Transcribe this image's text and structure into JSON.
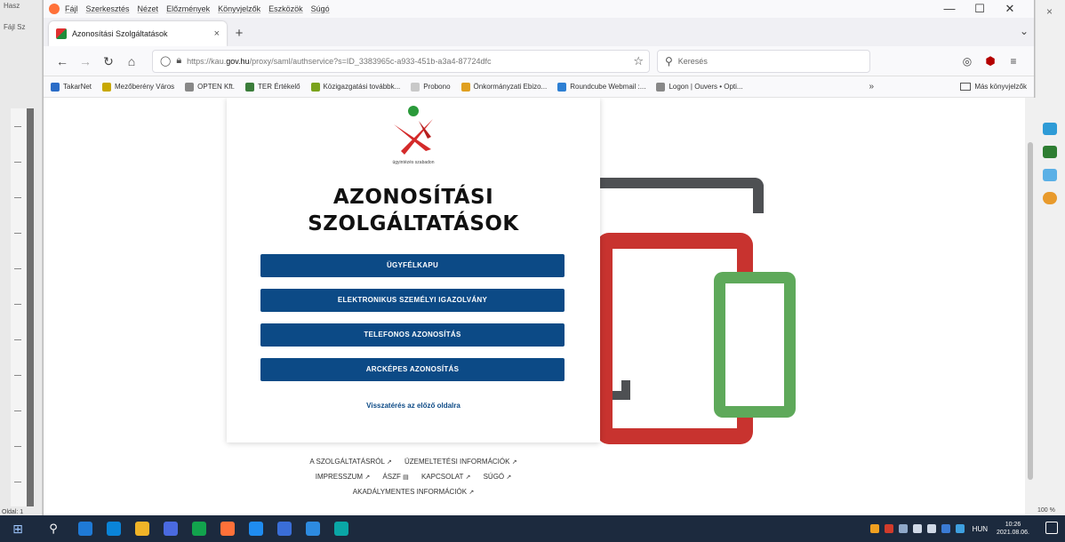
{
  "background_left_app": {
    "title": "Hasz",
    "menu": "Fájl  Sz",
    "status": "Oldal: 1"
  },
  "background_right_app": {
    "close": "×",
    "status": "100 %"
  },
  "browser": {
    "menu": [
      "Fájl",
      "Szerkesztés",
      "Nézet",
      "Előzmények",
      "Könyvjelzők",
      "Eszközök",
      "Súgó"
    ],
    "window_controls": {
      "minimize": "—",
      "maximize": "☐",
      "close": "✕"
    },
    "tab": {
      "title": "Azonosítási Szolgáltatások",
      "close": "×"
    },
    "new_tab": "+",
    "tabs_overflow": "⌄",
    "nav": {
      "back": "←",
      "forward": "→",
      "reload": "↻",
      "home": "⌂"
    },
    "url": {
      "prefix": "https://kau.",
      "domain": "gov.hu",
      "rest": "/proxy/saml/authservice?s=ID_3383965c-a933-451b-a3a4-87724dfc"
    },
    "star": "☆",
    "search_placeholder": "Keresés",
    "nav_right": {
      "pocket": "◎",
      "ublock": "⬢",
      "menu": "≡"
    },
    "bookmarks": [
      {
        "label": "TakarNet",
        "color": "#2a6cc7"
      },
      {
        "label": "Mezőberény Város",
        "color": "#c8a800"
      },
      {
        "label": "OPTEN Kft.",
        "color": "#888888"
      },
      {
        "label": "TER Értékelő",
        "color": "#3b7d3a"
      },
      {
        "label": "Közigazgatási továbbk...",
        "color": "#7aa31c"
      },
      {
        "label": "Probono",
        "color": "#c9c9c9"
      },
      {
        "label": "Önkormányzati Ebizo...",
        "color": "#e0a020"
      },
      {
        "label": "Roundcube Webmail :...",
        "color": "#2d7fd3"
      },
      {
        "label": "Logon | Ouvers • Opti...",
        "color": "#888888"
      }
    ],
    "bookmarks_more": "»",
    "bookmarks_other": "Más könyvjelzők"
  },
  "page": {
    "logo_caption": "ügyintézés szabadon",
    "title_line1": "AZONOSÍTÁSI",
    "title_line2": "SZOLGÁLTATÁSOK",
    "buttons": [
      "ÜGYFÉLKAPU",
      "ELEKTRONIKUS SZEMÉLYI IGAZOLVÁNY",
      "TELEFONOS AZONOSÍTÁS",
      "ARCKÉPES AZONOSÍTÁS"
    ],
    "back_link": "Visszatérés az előző oldalra",
    "footer": {
      "about": "A SZOLGÁLTATÁSRÓL",
      "operation": "ÜZEMELTETÉSI INFORMÁCIÓK",
      "imprint": "IMPRESSZUM",
      "aszf": "ÁSZF",
      "contact": "KAPCSOLAT",
      "help": "SÚGÓ",
      "accessibility": "AKADÁLYMENTES INFORMÁCIÓK"
    },
    "colors": {
      "button": "#0c4a86",
      "tablet": "#c8332f",
      "phone": "#5ea95a",
      "monitor": "#4e5053"
    }
  },
  "taskbar": {
    "apps": [
      "#1f7ad6",
      "#0a84d8",
      "#f0b428",
      "#4a6ae0",
      "#12a34d",
      "#ff7139",
      "#1f8cf0",
      "#3a6ed8",
      "#2d8be0",
      "#0aa6a6"
    ],
    "lang": "HUN",
    "time": "10:26",
    "date": "2021.08.06."
  }
}
